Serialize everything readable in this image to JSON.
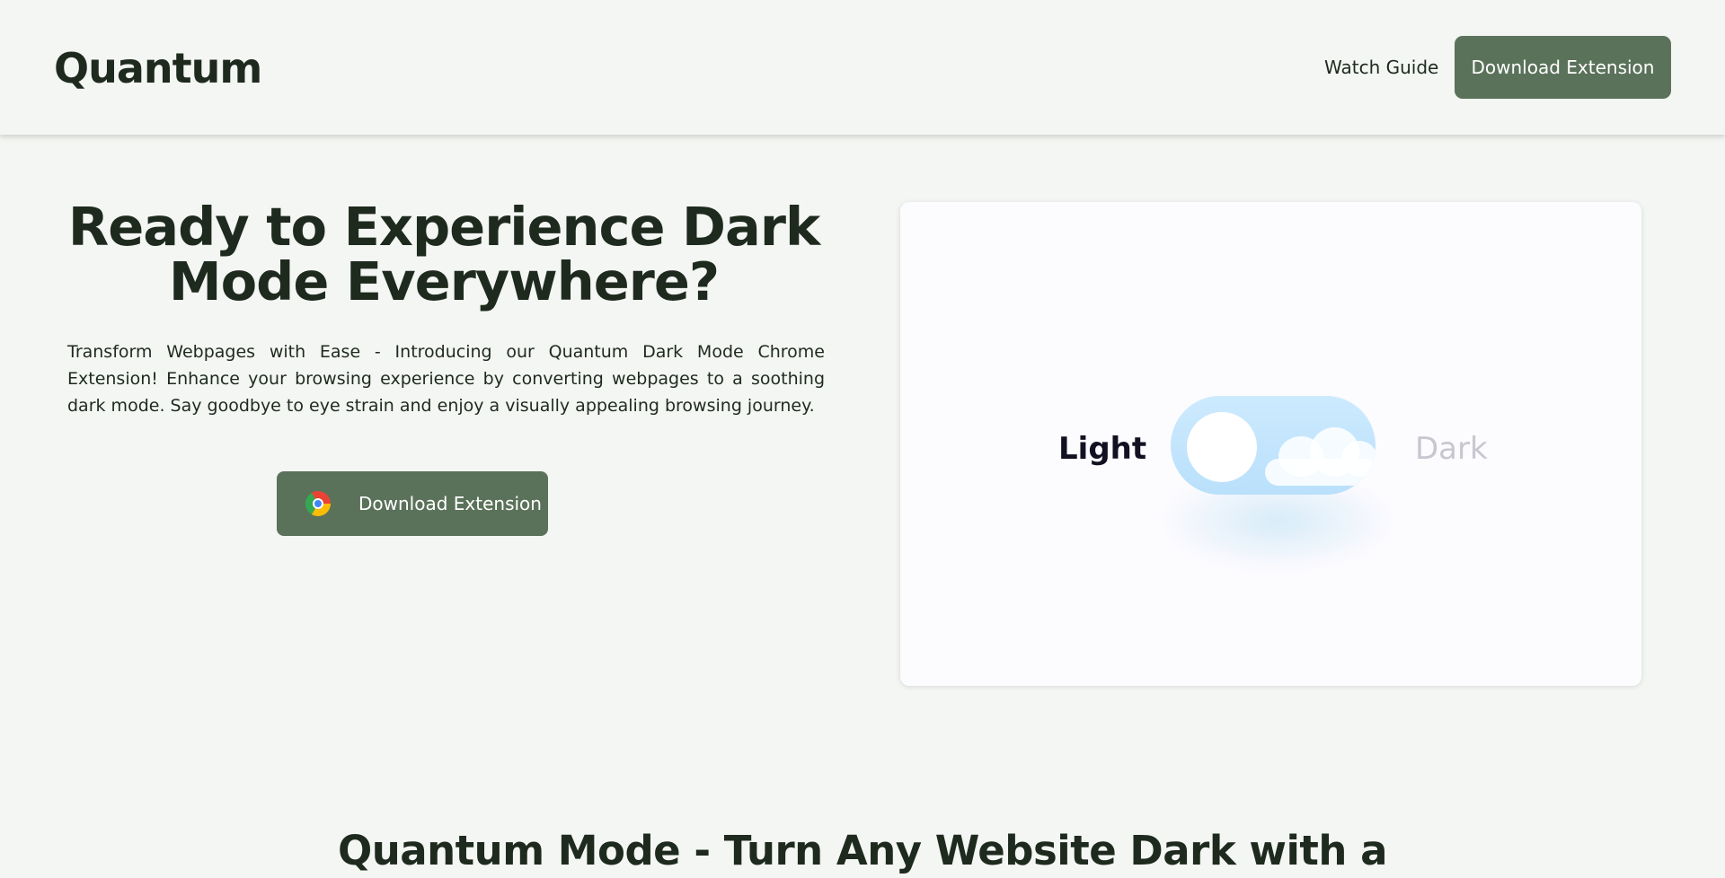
{
  "header": {
    "logo": "Quantum",
    "nav": {
      "watch_guide": "Watch Guide",
      "download": "Download Extension"
    }
  },
  "hero": {
    "title": "Ready to Experience Dark Mode Everywhere?",
    "description": "Transform Webpages with Ease - Introducing our Quantum Dark Mode Chrome Extension! Enhance your browsing experience by converting webpages to a soothing dark mode. Say goodbye to eye strain and enjoy a visually appealing browsing journey.",
    "cta": {
      "label": "Download Extension",
      "icon": "chrome-icon"
    }
  },
  "preview": {
    "light_label": "Light",
    "dark_label": "Dark",
    "toggle_state": "light"
  },
  "section2": {
    "title": "Quantum Mode - Turn Any Website Dark with a"
  },
  "colors": {
    "background": "#f3f6f2",
    "accent": "#5b725a",
    "text": "#1f2a1f",
    "card": "#fcfbfe",
    "toggle_track": "#b9e0fb"
  }
}
